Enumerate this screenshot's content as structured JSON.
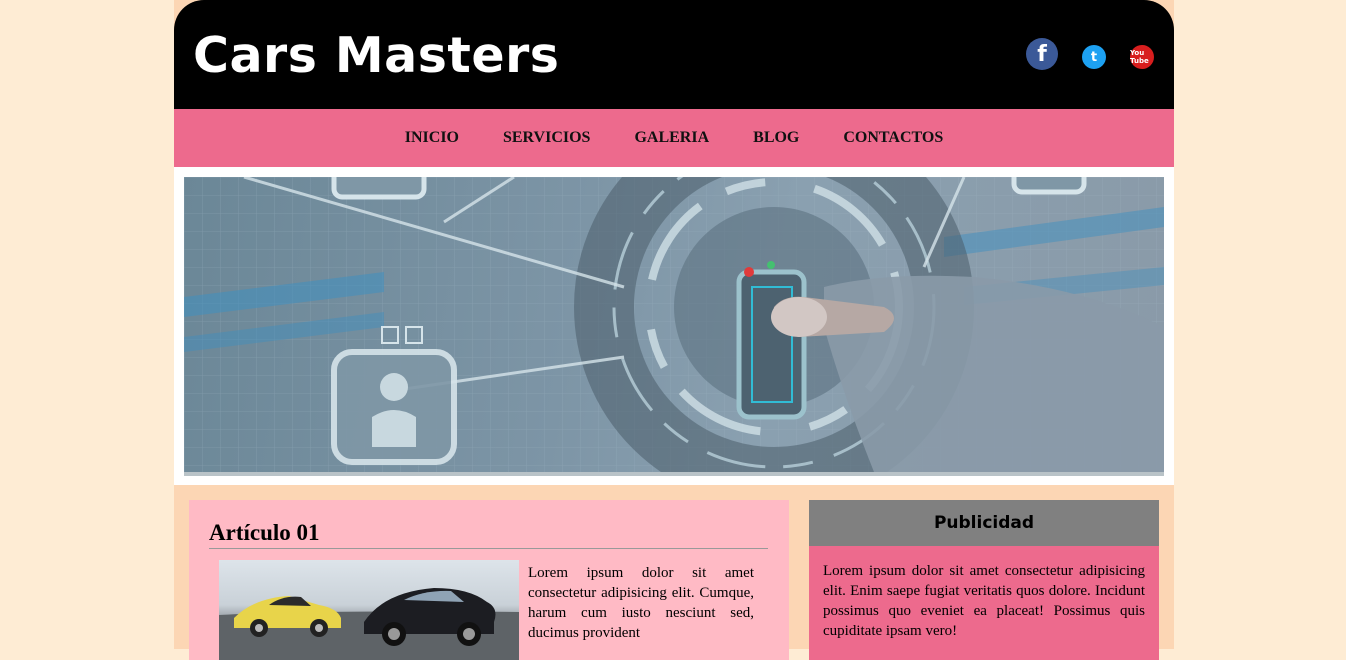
{
  "site": {
    "title": "Cars Masters"
  },
  "social": [
    {
      "name": "facebook-icon",
      "glyph": "f",
      "color": "#3b5998"
    },
    {
      "name": "twitter-icon",
      "glyph": "t",
      "color": "#1da1f2"
    },
    {
      "name": "youtube-icon",
      "glyph": "You Tube",
      "color": "#d81e1e"
    }
  ],
  "nav": {
    "items": [
      {
        "label": "INICIO"
      },
      {
        "label": "SERVICIOS"
      },
      {
        "label": "GALERIA"
      },
      {
        "label": "BLOG"
      },
      {
        "label": "CONTACTOS"
      }
    ]
  },
  "article": {
    "title": "Artículo 01",
    "text": "Lorem ipsum dolor sit amet consectetur adipisicing elit. Cumque, harum cum iusto nesciunt sed, ducimus provident"
  },
  "aside": {
    "title": "Publicidad",
    "text": "Lorem ipsum dolor sit amet consectetur adipisicing elit. Enim saepe fugiat veritatis quos dolore. Incidunt possimus quo eveniet ea placeat! Possimus quis cupiditate ipsam vero!"
  },
  "colors": {
    "page_bg": "#feecd4",
    "header_bg": "#000000",
    "nav_bg": "#ed6a8d",
    "article_bg": "#ffbac5",
    "aside_header_bg": "#808080"
  }
}
